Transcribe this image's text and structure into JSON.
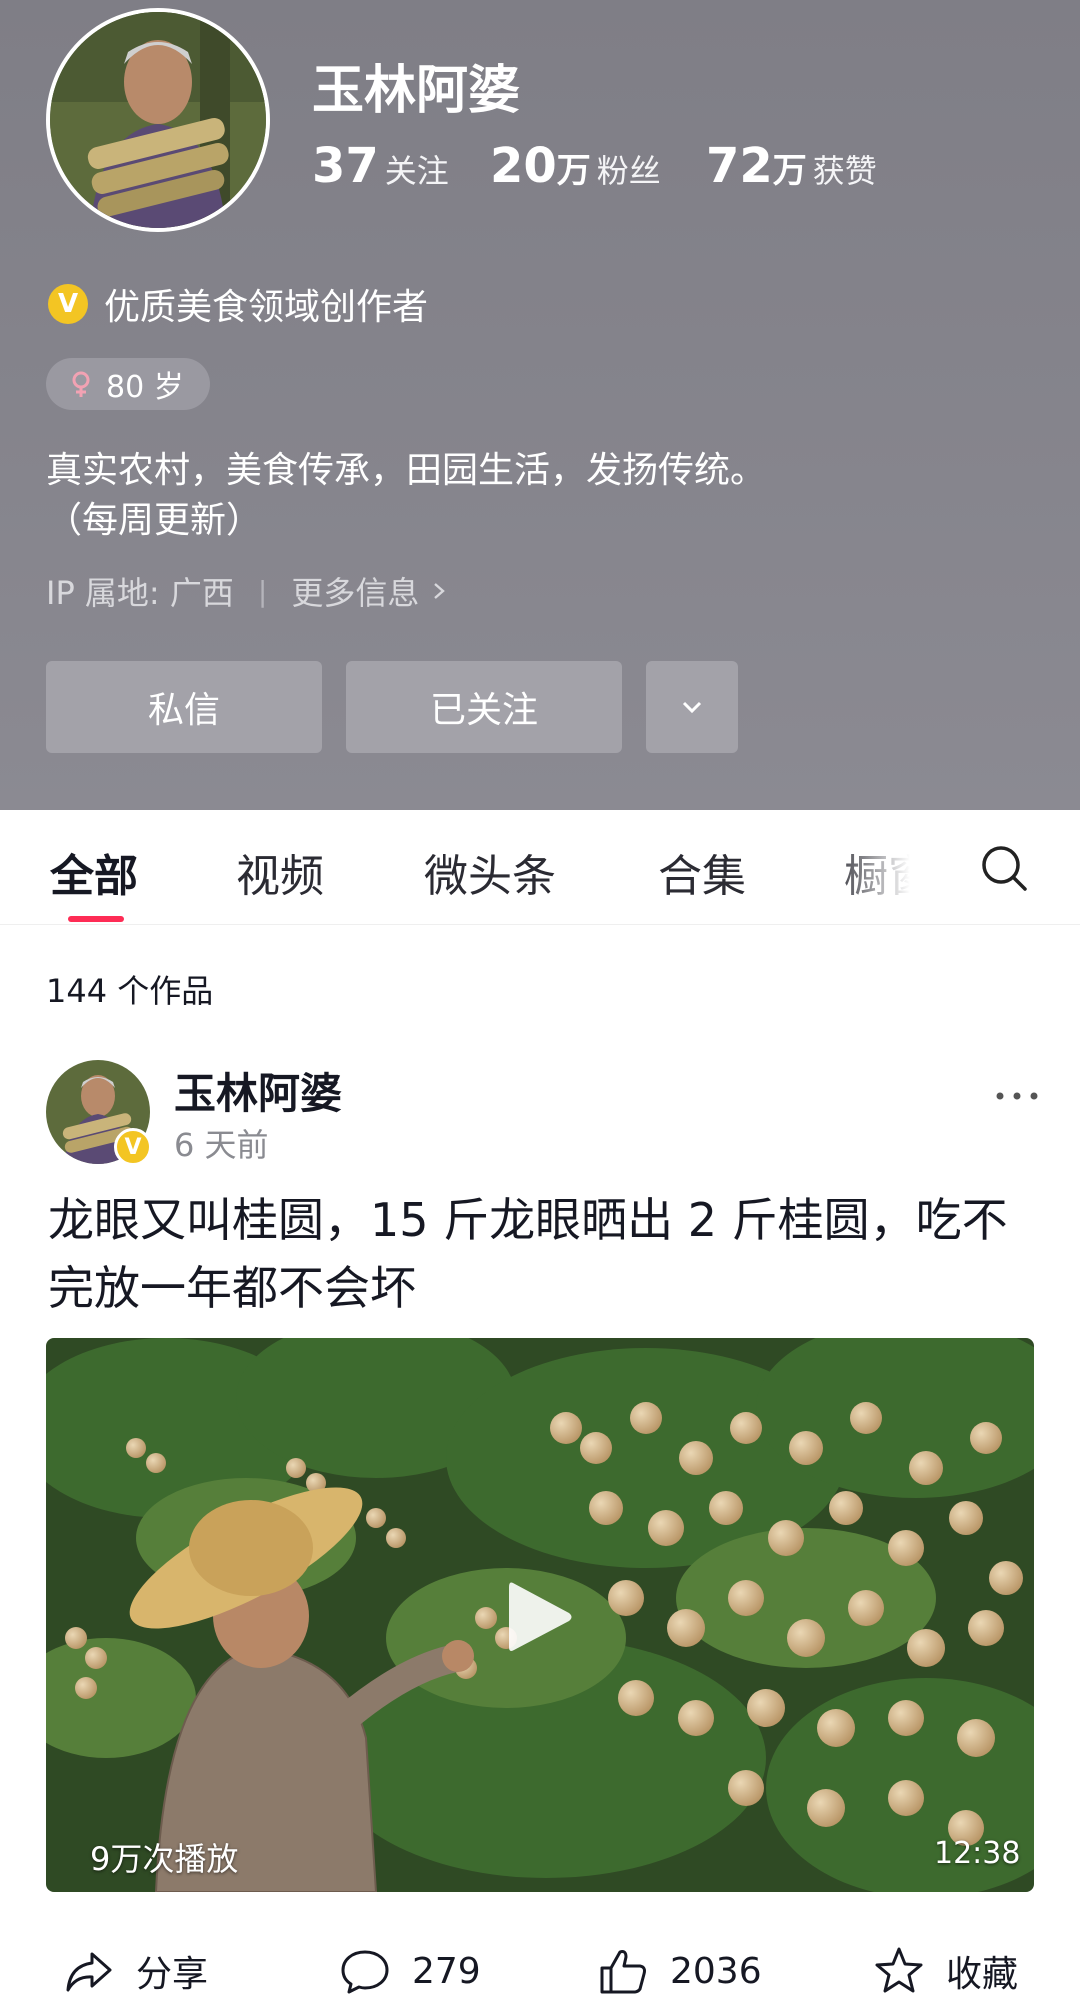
{
  "profile": {
    "name": "玉林阿婆",
    "stats": [
      {
        "num": "37",
        "unit": "",
        "label": "关注"
      },
      {
        "num": "20",
        "unit": "万",
        "label": "粉丝"
      },
      {
        "num": "72",
        "unit": "万",
        "label": "获赞"
      }
    ],
    "verified_mark": "V",
    "verified_text": "优质美食领域创作者",
    "age": "80 岁",
    "bio_line1": "真实农村，美食传承，田园生活，发扬传统。",
    "bio_line2": "（每周更新）",
    "ip": "IP 属地: 广西",
    "separator": "|",
    "more_info": "更多信息"
  },
  "buttons": {
    "message": "私信",
    "following": "已关注"
  },
  "tabs": [
    "全部",
    "视频",
    "微头条",
    "合集",
    "橱窗"
  ],
  "works_count": "144 个作品",
  "post": {
    "author": "玉林阿婆",
    "time": "6 天前",
    "title": "龙眼又叫桂圆，15 斤龙眼晒出 2 斤桂圆，吃不完放一年都不会坏",
    "plays": "9万次播放",
    "duration": "12:38",
    "actions": {
      "share": "分享",
      "comments": "279",
      "likes": "2036",
      "favorite": "收藏"
    }
  },
  "colors": {
    "header_bg": "#85848c",
    "accent": "#fe2c55",
    "verified": "#f3c523"
  },
  "icons": [
    "verified-badge-icon",
    "female-icon",
    "chevron-right-icon",
    "chevron-down-icon",
    "search-icon",
    "more-icon",
    "play-icon",
    "share-icon",
    "comment-icon",
    "like-icon",
    "star-icon"
  ]
}
